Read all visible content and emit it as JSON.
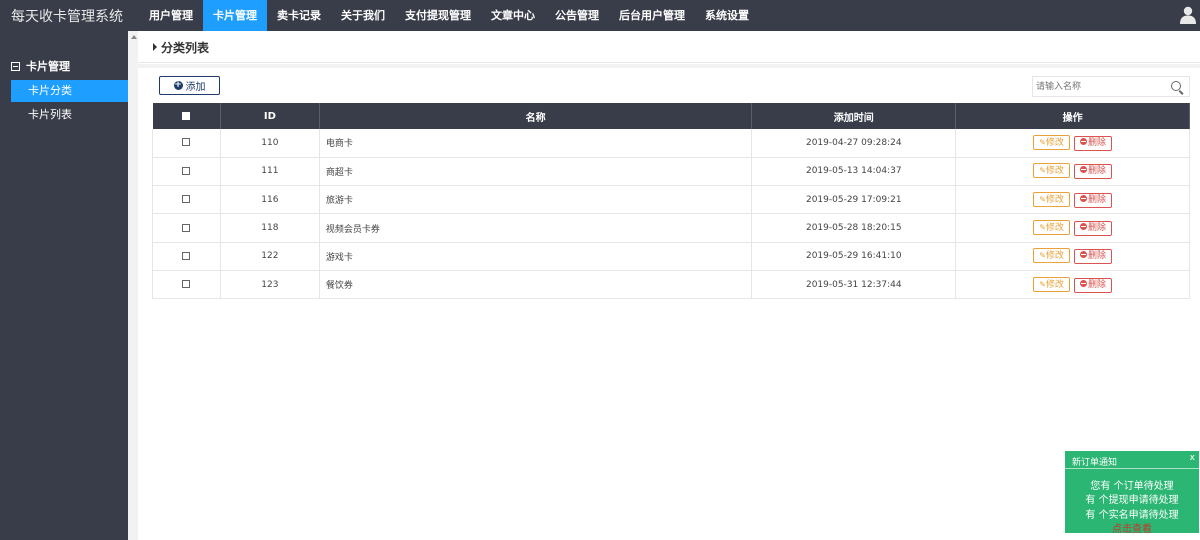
{
  "app": {
    "title": "每天收卡管理系统"
  },
  "nav": [
    {
      "label": "用户管理",
      "active": false
    },
    {
      "label": "卡片管理",
      "active": true
    },
    {
      "label": "卖卡记录",
      "active": false
    },
    {
      "label": "关于我们",
      "active": false
    },
    {
      "label": "支付提现管理",
      "active": false
    },
    {
      "label": "文章中心",
      "active": false
    },
    {
      "label": "公告管理",
      "active": false
    },
    {
      "label": "后台用户管理",
      "active": false
    },
    {
      "label": "系统设置",
      "active": false
    }
  ],
  "header": {
    "user_icon": "user-icon"
  },
  "sidebar": {
    "group": "卡片管理",
    "items": [
      {
        "label": "卡片分类",
        "active": true
      },
      {
        "label": "卡片列表",
        "active": false
      }
    ]
  },
  "page": {
    "title": "分类列表",
    "add_label": "添加",
    "search_placeholder": "请输入名称"
  },
  "table": {
    "headers": [
      "ID",
      "名称",
      "添加时间",
      "操作"
    ],
    "rows": [
      {
        "id": "110",
        "name": "电商卡",
        "time": "2019-04-27 09:28:24"
      },
      {
        "id": "111",
        "name": "商超卡",
        "time": "2019-05-13 14:04:37"
      },
      {
        "id": "116",
        "name": "旅游卡",
        "time": "2019-05-29 17:09:21"
      },
      {
        "id": "118",
        "name": "视频会员卡券",
        "time": "2019-05-28 18:20:15"
      },
      {
        "id": "122",
        "name": "游戏卡",
        "time": "2019-05-29 16:41:10"
      },
      {
        "id": "123",
        "name": "餐饮券",
        "time": "2019-05-31 12:37:44"
      }
    ],
    "edit_label": "修改",
    "delete_label": "删除"
  },
  "notice": {
    "title": "新订单通知",
    "close": "x",
    "line1": "您有 个订单待处理",
    "line2": "有 个提现申请待处理",
    "line3": "有 个实名申请待处理",
    "link": "点击查看"
  },
  "colors": {
    "topbar": "#393d49",
    "accent": "#1e9fff",
    "notice": "#2bb673",
    "edit": "#e9a23b",
    "delete": "#d9534f"
  }
}
